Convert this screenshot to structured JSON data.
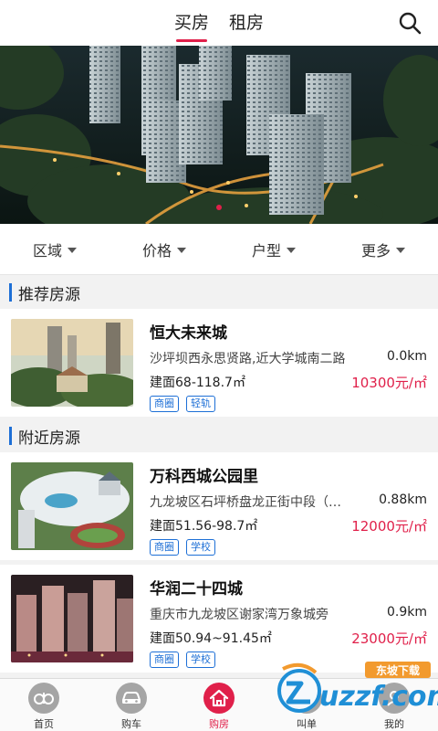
{
  "header": {
    "tabs": [
      {
        "label": "买房",
        "active": true
      },
      {
        "label": "租房",
        "active": false
      }
    ],
    "search_icon": "search-icon"
  },
  "banner": {
    "image": "aerial-night-residential-towers",
    "dots": 1
  },
  "filters": [
    {
      "label": "区域"
    },
    {
      "label": "价格"
    },
    {
      "label": "户型"
    },
    {
      "label": "更多"
    }
  ],
  "sections": {
    "recommended": {
      "title": "推荐房源",
      "items": [
        {
          "name": "恒大未来城",
          "address": "沙坪坝西永思贤路,近大学城南二路",
          "distance": "0.0km",
          "area": "建面68-118.7㎡",
          "price": "10300元/㎡",
          "tags": [
            "商圈",
            "轻轨"
          ]
        }
      ]
    },
    "nearby": {
      "title": "附近房源",
      "items": [
        {
          "name": "万科西城公园里",
          "address": "九龙坡区石坪桥盘龙正街中段（蟠龙小…",
          "distance": "0.88km",
          "area": "建面51.56-98.7㎡",
          "price": "12000元/㎡",
          "tags": [
            "商圈",
            "学校"
          ]
        },
        {
          "name": "华润二十四城",
          "address": "重庆市九龙坡区谢家湾万象城旁",
          "distance": "0.9km",
          "area": "建面50.94~91.45㎡",
          "price": "23000元/㎡",
          "tags": [
            "商圈",
            "学校"
          ]
        }
      ]
    }
  },
  "bottom_nav": [
    {
      "label": "首页",
      "icon": "home-logo-icon",
      "active": false
    },
    {
      "label": "购车",
      "icon": "car-icon",
      "active": false
    },
    {
      "label": "购房",
      "icon": "house-icon",
      "active": true
    },
    {
      "label": "叫单",
      "icon": "order-icon",
      "active": false
    },
    {
      "label": "我的",
      "icon": "profile-icon",
      "active": false
    }
  ],
  "watermark": {
    "text": "uzzf.com",
    "subtext": "东坡下载"
  },
  "colors": {
    "accent": "#e0204a",
    "tag_blue": "#1d6fd6",
    "background": "#f2f2f2"
  }
}
